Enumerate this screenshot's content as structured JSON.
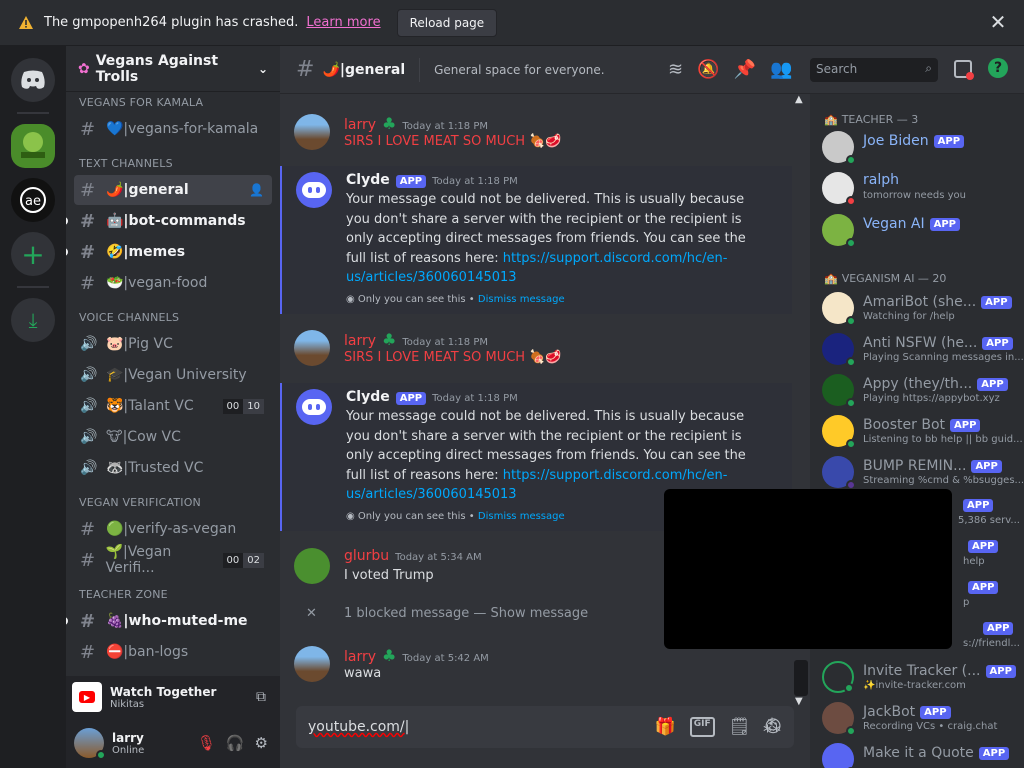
{
  "banner": {
    "message": "The gmpopenh264 plugin has crashed.",
    "learn_more": "Learn more",
    "reload": "Reload page"
  },
  "guild": {
    "name": "Vegans Against Trolls"
  },
  "categories": {
    "vegans_for_kamala": "VEGANS FOR KAMALA",
    "text": "TEXT CHANNELS",
    "voice": "VOICE CHANNELS",
    "verification": "VEGAN VERIFICATION",
    "teacher": "TEACHER ZONE"
  },
  "channels": {
    "vegans_for_kamala": "💙|vegans-for-kamala",
    "general": "🌶️|general",
    "bot_commands": "🤖|bot-commands",
    "memes": "🤣|memes",
    "vegan_food": "🥗|vegan-food",
    "pig_vc": "🐷|Pig VC",
    "vegan_university": "🎓|Vegan University",
    "talant_vc": "🐯|Talant VC",
    "talant_count_a": "00",
    "talant_count_b": "10",
    "cow_vc": "🐮|Cow VC",
    "trusted_vc": "🦝|Trusted VC",
    "verify_as_vegan": "🟢|verify-as-vegan",
    "vegan_verifi": "🌱|Vegan Verifi...",
    "verifi_count_a": "00",
    "verifi_count_b": "02",
    "who_muted_me": "🍇|who-muted-me",
    "ban_logs": "⛔|ban-logs"
  },
  "activity": {
    "title": "Watch Together",
    "subtitle": "Nikitas"
  },
  "user": {
    "name": "larry",
    "status": "Online"
  },
  "topbar": {
    "channel": "🌶️|general",
    "topic": "General space for everyone.",
    "search_placeholder": "Search"
  },
  "messages": [
    {
      "author": "larry",
      "time": "Today at 1:18 PM",
      "text": "SIRS I LOVE MEAT SO MUCH 🍖🥩"
    },
    {
      "author": "Clyde",
      "badge": "APP",
      "time": "Today at 1:18 PM",
      "text": "Your message could not be delivered. This is usually because you don't share a server with the recipient or the recipient is only accepting direct messages from friends. You can see the full list of reasons here: ",
      "link": "https://support.discord.com/hc/en-us/articles/360060145013",
      "only_you": "Only you can see this •",
      "dismiss": "Dismiss message"
    },
    {
      "author": "larry",
      "time": "Today at 1:18 PM",
      "text": "SIRS I LOVE MEAT SO MUCH 🍖🥩"
    },
    {
      "author": "Clyde",
      "badge": "APP",
      "time": "Today at 1:18 PM",
      "text": "Your message could not be delivered. This is usually because you don't share a server with the recipient or the recipient is only accepting direct messages from friends. You can see the full list of reasons here: ",
      "link": "https://support.discord.com/hc/en-us/articles/360060145013",
      "only_you": "Only you can see this •",
      "dismiss": "Dismiss message"
    },
    {
      "author": "glurbu",
      "time": "Today at 5:34 AM",
      "text": "I voted Trump"
    },
    {
      "author": "larry",
      "time": "Today at 5:42 AM",
      "text": "wawa"
    }
  ],
  "blocked": {
    "text": "1 blocked message — ",
    "show": "Show message"
  },
  "composer": {
    "value": "youtube.com/"
  },
  "member_groups": {
    "teacher": "TEACHER — 3",
    "veganism_ai": "VEGANISM AI — 20"
  },
  "members": [
    {
      "name": "Joe Biden",
      "badge": "APP"
    },
    {
      "name": "ralph",
      "status": "tomorrow needs you"
    },
    {
      "name": "Vegan AI",
      "badge": "APP"
    },
    {
      "name": "AmariBot (she...",
      "badge": "APP",
      "status": "Watching for /help"
    },
    {
      "name": "Anti NSFW (he...",
      "badge": "APP",
      "status": "Playing Scanning messages in..."
    },
    {
      "name": "Appy (they/th...",
      "badge": "APP",
      "status": "Playing https://appybot.xyz"
    },
    {
      "name": "Booster Bot",
      "badge": "APP",
      "status": "Listening to bb help || bb guid..."
    },
    {
      "name": "BUMP REMIN...",
      "badge": "APP",
      "status": "Streaming %cmd & %bsugges..."
    },
    {
      "name": "",
      "badge": "APP",
      "status": "5,386 serv..."
    },
    {
      "name": "",
      "badge": "APP",
      "status": "help"
    },
    {
      "name": "",
      "badge": "APP",
      "status": "p"
    },
    {
      "name": "",
      "badge": "APP",
      "status": "s://friendl..."
    },
    {
      "name": "Invite Tracker (...",
      "badge": "APP",
      "status": "✨invite-tracker.com"
    },
    {
      "name": "JackBot",
      "badge": "APP",
      "status": "Recording VCs • craig.chat"
    },
    {
      "name": "Make it a Quote",
      "badge": "APP"
    }
  ]
}
